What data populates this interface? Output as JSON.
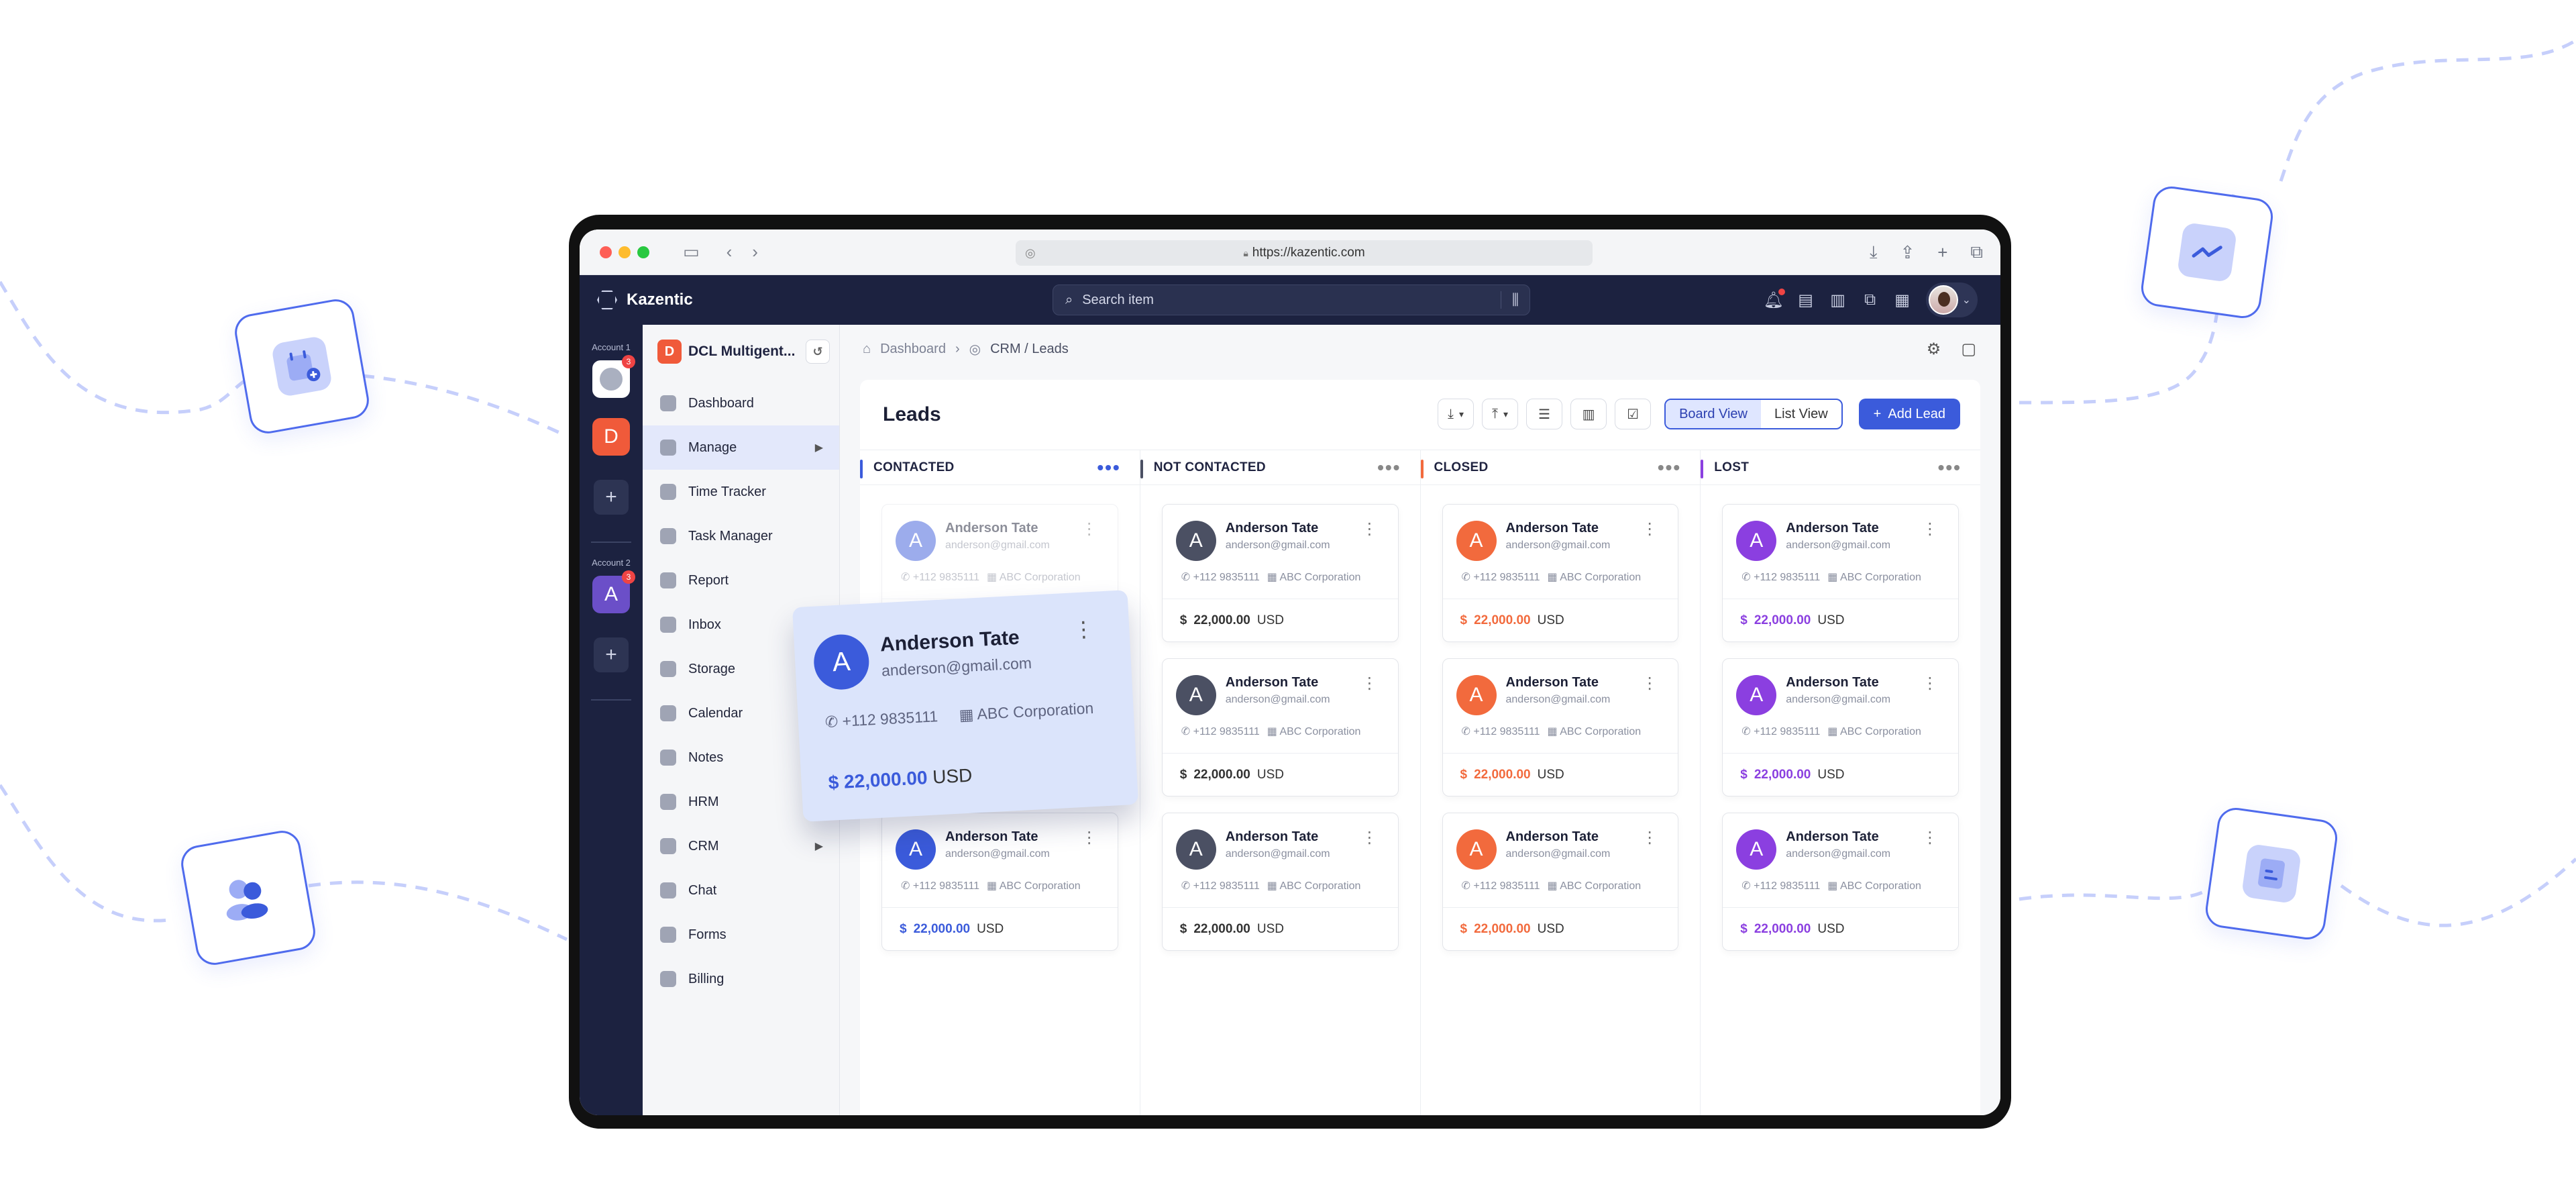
{
  "browser": {
    "url": "https://kazentic.com",
    "dot_colors": [
      "#fe5f57",
      "#febc2e",
      "#28c840"
    ]
  },
  "app": {
    "name": "Kazentic",
    "search_placeholder": "Search item"
  },
  "rail": {
    "account1_label": "Account 1",
    "account1_badge": "3",
    "workspace_letter": "D",
    "account2_label": "Account 2",
    "account2_letter": "A",
    "account2_badge": "3",
    "add": "+"
  },
  "sidebar": {
    "workspace_letter": "D",
    "workspace_name": "DCL Multigent...",
    "items": [
      {
        "label": "Dashboard",
        "icon": "dashboard-icon"
      },
      {
        "label": "Manage",
        "icon": "manage-icon"
      },
      {
        "label": "Time Tracker",
        "icon": "clock-icon"
      },
      {
        "label": "Task Manager",
        "icon": "task-icon"
      },
      {
        "label": "Report",
        "icon": "report-icon"
      },
      {
        "label": "Inbox",
        "icon": "inbox-icon"
      },
      {
        "label": "Storage",
        "icon": "storage-icon"
      },
      {
        "label": "Calendar",
        "icon": "calendar-icon"
      },
      {
        "label": "Notes",
        "icon": "notes-icon"
      },
      {
        "label": "HRM",
        "icon": "hrm-icon"
      },
      {
        "label": "CRM",
        "icon": "crm-icon"
      },
      {
        "label": "Chat",
        "icon": "chat-icon"
      },
      {
        "label": "Forms",
        "icon": "forms-icon"
      },
      {
        "label": "Billing",
        "icon": "billing-icon"
      }
    ]
  },
  "breadcrumb": {
    "home": "Dashboard",
    "current": "CRM / Leads"
  },
  "leads": {
    "title": "Leads",
    "board_view": "Board View",
    "list_view": "List View",
    "add_lead": "Add Lead",
    "columns": [
      {
        "label": "CONTACTED",
        "color": "#3b5bdb"
      },
      {
        "label": "NOT CONTACTED",
        "color": "#4b5063"
      },
      {
        "label": "CLOSED",
        "color": "#f26a3d"
      },
      {
        "label": "LOST",
        "color": "#8b3fe0"
      }
    ],
    "card": {
      "name": "Anderson Tate",
      "email": "anderson@gmail.com",
      "phone": "+112 9835111",
      "company": "ABC Corporation",
      "amount": "22,000.00",
      "currency": "USD",
      "initial": "A"
    },
    "drag_card": {
      "name": "Anderson Tate",
      "email": "anderson@gmail.com",
      "phone": "+112 9835111",
      "company": "ABC Corporation",
      "amount": "22,000.00",
      "currency": "USD",
      "initial": "A"
    }
  },
  "colors": {
    "accent": "#3b5bdb",
    "dark": "#1c2240",
    "closed": "#f26a3d",
    "lost": "#8b3fe0",
    "not_contacted": "#4b5063"
  }
}
